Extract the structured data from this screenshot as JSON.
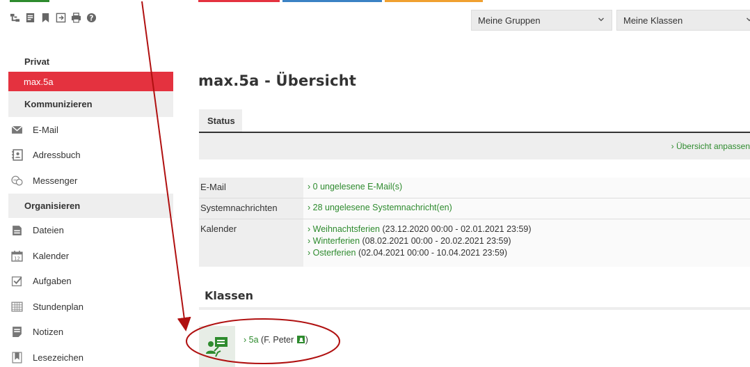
{
  "colors": {
    "accent": "#e4323f",
    "link": "#2e8b2e",
    "annotation": "#b01010",
    "strip_red": "#e4323f",
    "strip_blue": "#3b82c4",
    "strip_orange": "#f0a030"
  },
  "toolbar": {
    "icons": [
      "sitemap-icon",
      "notes-icon",
      "bookmark-icon",
      "logout-icon",
      "print-icon",
      "help-icon"
    ]
  },
  "header": {
    "groups_select": "Meine Gruppen",
    "classes_select": "Meine Klassen"
  },
  "sidebar": {
    "section_private": "Privat",
    "active_item": "max.5a",
    "section_communicate": "Kommunizieren",
    "communicate_items": [
      {
        "label": "E-Mail",
        "icon": "envelope-icon"
      },
      {
        "label": "Adressbuch",
        "icon": "addressbook-icon"
      },
      {
        "label": "Messenger",
        "icon": "messenger-icon"
      }
    ],
    "section_organize": "Organisieren",
    "organize_items": [
      {
        "label": "Dateien",
        "icon": "files-icon"
      },
      {
        "label": "Kalender",
        "icon": "calendar-icon"
      },
      {
        "label": "Aufgaben",
        "icon": "tasks-icon"
      },
      {
        "label": "Stundenplan",
        "icon": "timetable-icon"
      },
      {
        "label": "Notizen",
        "icon": "notes-icon"
      },
      {
        "label": "Lesezeichen",
        "icon": "bookmark-icon"
      }
    ]
  },
  "main": {
    "title": "max.5a - Übersicht",
    "tab_status": "Status",
    "customize_link": "Übersicht anpassen",
    "rows": {
      "email": {
        "label": "E-Mail",
        "value": "0 ungelesene E-Mail(s)"
      },
      "system": {
        "label": "Systemnachrichten",
        "value": "28 ungelesene Systemnachricht(en)"
      },
      "calendar": {
        "label": "Kalender",
        "events": [
          {
            "name": "Weihnachtsferien",
            "range": "(23.12.2020 00:00 - 02.01.2021 23:59)"
          },
          {
            "name": "Winterferien",
            "range": "(08.02.2021 00:00 - 20.02.2021 23:59)"
          },
          {
            "name": "Osterferien",
            "range": "(02.04.2021 00:00 - 10.04.2021 23:59)"
          }
        ]
      }
    },
    "classes_heading": "Klassen",
    "class_entry": {
      "name": "5a",
      "teacher": "(F. Peter",
      "close": ")"
    }
  }
}
